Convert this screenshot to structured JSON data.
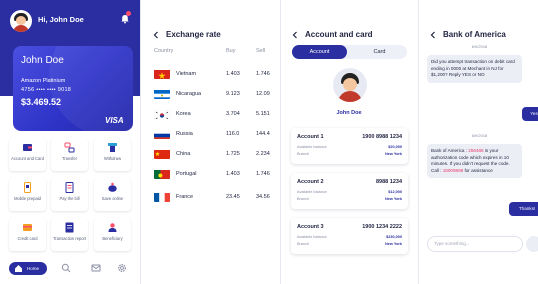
{
  "colors": {
    "primary": "#2a2ea1",
    "accent": "#e63a6c",
    "notification": "#ff4d6a"
  },
  "home": {
    "greeting": "Hi, John Doe",
    "card": {
      "holder": "John Doe",
      "type": "Amazon Platinium",
      "number": "4756 •••• •••• 9018",
      "balance": "$3.469.52",
      "brand": "VISA"
    },
    "menu": [
      {
        "label": "Account and Card",
        "icon": "wallet-icon"
      },
      {
        "label": "Transfer",
        "icon": "transfer-icon"
      },
      {
        "label": "Withdraw",
        "icon": "withdraw-icon"
      },
      {
        "label": "Mobile prepaid",
        "icon": "mobile-icon"
      },
      {
        "label": "Pay the bill",
        "icon": "bill-icon"
      },
      {
        "label": "Save online",
        "icon": "piggy-bank-icon"
      },
      {
        "label": "Credit card",
        "icon": "credit-card-icon"
      },
      {
        "label": "Transaction report",
        "icon": "report-icon"
      },
      {
        "label": "Beneficiary",
        "icon": "beneficiary-icon"
      }
    ],
    "nav": {
      "home_label": "Home"
    }
  },
  "exchange": {
    "title": "Exchange rate",
    "headers": {
      "country": "Country",
      "buy": "Buy",
      "sell": "Sell"
    },
    "rows": [
      {
        "country": "Vietnam",
        "buy": "1.403",
        "sell": "1.746"
      },
      {
        "country": "Nicaragua",
        "buy": "9.123",
        "sell": "12.09"
      },
      {
        "country": "Korea",
        "buy": "3.704",
        "sell": "5.151"
      },
      {
        "country": "Russia",
        "buy": "116.0",
        "sell": "144.4"
      },
      {
        "country": "China",
        "buy": "1.725",
        "sell": "2.234"
      },
      {
        "country": "Portugal",
        "buy": "1.403",
        "sell": "1.746"
      },
      {
        "country": "France",
        "buy": "23.45",
        "sell": "34.56"
      }
    ]
  },
  "accounts": {
    "title": "Account and card",
    "tabs": [
      "Account",
      "Card"
    ],
    "profile_name": "John Doe",
    "items": [
      {
        "name": "Account 1",
        "number": "1900 8988 1234",
        "balance_label": "Available balance",
        "balance": "$20,000",
        "branch_label": "Branch",
        "branch": "New York"
      },
      {
        "name": "Account 2",
        "number": "8988 1234",
        "balance_label": "Available balance",
        "balance": "$12,000",
        "branch_label": "Branch",
        "branch": "New York"
      },
      {
        "name": "Account 3",
        "number": "1900 1234 2222",
        "balance_label": "Available balance",
        "balance": "$230,000",
        "branch_label": "Branch",
        "branch": "New York"
      }
    ]
  },
  "chat": {
    "title": "Bank of America",
    "date1": "6/9/2018",
    "msg1": "Did you attempt transaction on debit card ending in 0000 at Mechant in NJ for $1,200? Reply YES or NO",
    "reply1": "Yes",
    "date2": "6/9/2018",
    "msg2_a": "Bank of America : ",
    "msg2_code": "256486",
    "msg2_b": " is your authorization code which expires in 10 minutes. If you didn't request the code. Call : ",
    "msg2_phone": "18009898",
    "msg2_c": " for assistance",
    "reply2": "Thanks!",
    "input_placeholder": "Type something..."
  }
}
